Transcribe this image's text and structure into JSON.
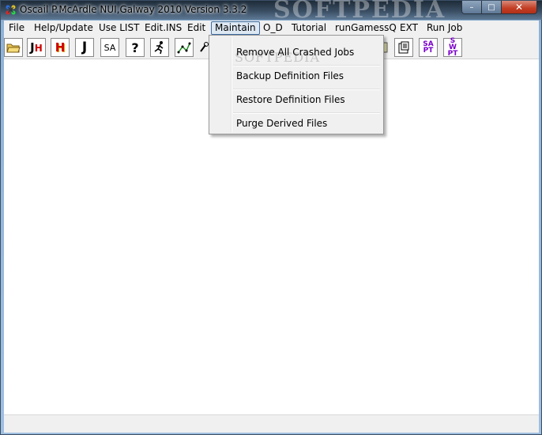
{
  "window": {
    "title": "Oscail P.McArdle NUI,Galway 2010 Version 3.3.2",
    "watermark": "SOFTPEDIA",
    "controls": {
      "minimize": "–",
      "maximize": "□",
      "close": "✕"
    }
  },
  "menubar": {
    "items": [
      {
        "label": "File"
      },
      {
        "label": "Help/Update"
      },
      {
        "label": "Use LIST"
      },
      {
        "label": "Edit.INS"
      },
      {
        "label": "Edit"
      },
      {
        "label": "Maintain",
        "active": true
      },
      {
        "label": "O_D"
      },
      {
        "label": "Tutorial"
      },
      {
        "label": "runGamessQ"
      },
      {
        "label": "EXT"
      },
      {
        "label": "Run Job"
      }
    ]
  },
  "toolbar": {
    "buttons": [
      {
        "icon": "open-folder-icon",
        "text": ""
      },
      {
        "icon": "jh-icon",
        "text": "JH"
      },
      {
        "icon": "h-icon",
        "text": "H"
      },
      {
        "icon": "j-icon",
        "text": "J"
      },
      {
        "icon": "sa-icon",
        "text": "SA"
      },
      {
        "icon": "help-icon",
        "text": "?"
      },
      {
        "icon": "runner-icon",
        "text": ""
      },
      {
        "icon": "molecule-icon",
        "text": ""
      },
      {
        "icon": "tool-icon",
        "text": ""
      },
      {
        "icon": "document-icon",
        "text": ""
      },
      {
        "icon": "properties-icon",
        "text": ""
      },
      {
        "icon": "sapt-icon",
        "text": "SA PT"
      },
      {
        "icon": "swpt-icon",
        "text": "SW PT"
      }
    ]
  },
  "maintain_menu": {
    "items": [
      {
        "label": "Remove All Crashed Jobs"
      },
      {
        "label": "Backup Definition Files"
      },
      {
        "label": "Restore Definition Files"
      },
      {
        "label": "Purge Derived Files"
      }
    ]
  },
  "colors": {
    "accent": "#3c6a9f",
    "close": "#c23d22",
    "toolbar_text_red": "#cc0000",
    "toolbar_text_purple": "#7a00c8"
  }
}
